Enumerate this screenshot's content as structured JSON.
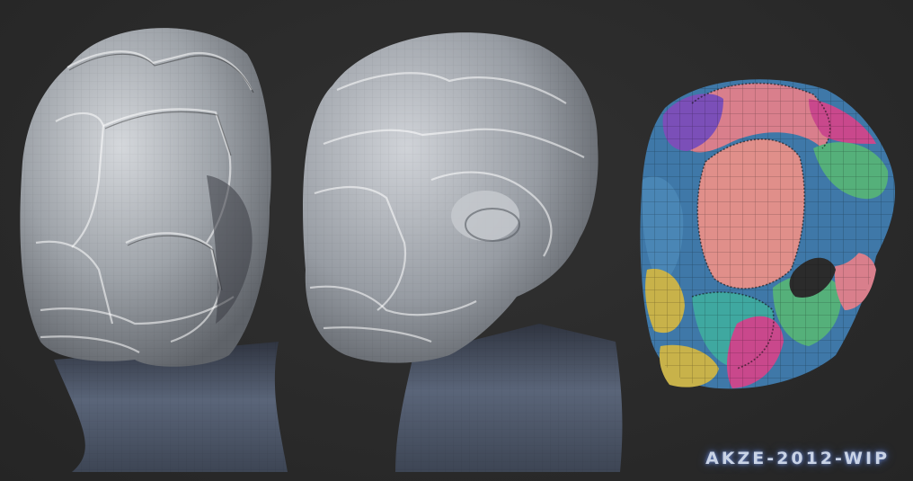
{
  "watermark": "AKZE-2012-WIP",
  "colors": {
    "background": "#2b2b2b",
    "helmet_clay": "#a9adb3",
    "neck_clay": "#4b5566",
    "uv_pink": "#d97f8c",
    "uv_magenta": "#c9488c",
    "uv_green": "#55b07a",
    "uv_blue": "#3f78a8",
    "uv_purple": "#7b4fb8",
    "uv_yellow": "#c8b24a"
  },
  "views": [
    {
      "name": "front-three-quarter-view"
    },
    {
      "name": "side-view"
    },
    {
      "name": "uv-polygroup-view"
    }
  ]
}
